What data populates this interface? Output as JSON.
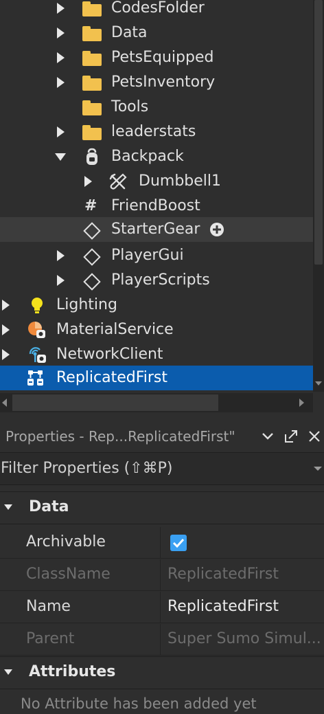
{
  "explorer": {
    "items": [
      {
        "label": "CodesFolder",
        "icon": "folder-icon",
        "arrow": "right"
      },
      {
        "label": "Data",
        "icon": "folder-icon",
        "arrow": "right"
      },
      {
        "label": "PetsEquipped",
        "icon": "folder-icon",
        "arrow": "right"
      },
      {
        "label": "PetsInventory",
        "icon": "folder-icon",
        "arrow": "right"
      },
      {
        "label": "Tools",
        "icon": "folder-icon",
        "arrow": ""
      },
      {
        "label": "leaderstats",
        "icon": "folder-icon",
        "arrow": "right"
      },
      {
        "label": "Backpack",
        "icon": "backpack-icon",
        "arrow": "down"
      },
      {
        "label": "Dumbbell1",
        "icon": "tool-icon",
        "arrow": "right"
      },
      {
        "label": "FriendBoost",
        "icon": "hash-icon",
        "arrow": ""
      },
      {
        "label": "StarterGear",
        "icon": "diamond-icon",
        "arrow": ""
      },
      {
        "label": "PlayerGui",
        "icon": "diamond-icon",
        "arrow": "right"
      },
      {
        "label": "PlayerScripts",
        "icon": "diamond-icon",
        "arrow": "right"
      },
      {
        "label": "Lighting",
        "icon": "lightbulb-icon",
        "arrow": "right"
      },
      {
        "label": "MaterialService",
        "icon": "material-service-icon",
        "arrow": "right"
      },
      {
        "label": "NetworkClient",
        "icon": "network-client-icon",
        "arrow": "right"
      },
      {
        "label": "ReplicatedFirst",
        "icon": "replicated-first-icon",
        "arrow": ""
      }
    ]
  },
  "properties": {
    "title": "Properties - Rep...ReplicatedFirst\"",
    "filter_placeholder": "Filter Properties (⇧⌘P)",
    "sections": {
      "data": "Data",
      "attributes": "Attributes"
    },
    "rows": [
      {
        "name": "Archivable",
        "value": "",
        "checked": true
      },
      {
        "name": "ClassName",
        "value": "ReplicatedFirst"
      },
      {
        "name": "Name",
        "value": "ReplicatedFirst"
      },
      {
        "name": "Parent",
        "value": "Super Sumo Simul..."
      }
    ],
    "no_attributes": "No Attribute has been added yet"
  },
  "colors": {
    "selection": "#0b5cad",
    "folder": "#f2c14e",
    "checkbox": "#3aa0f2"
  }
}
